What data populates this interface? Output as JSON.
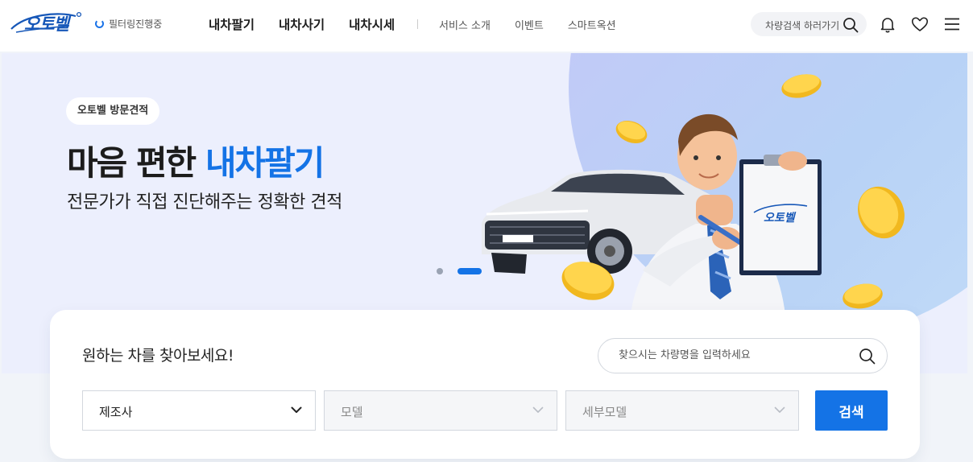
{
  "header": {
    "logo_text": "오토벨",
    "filter_status": "필터링진행중",
    "nav_main": [
      "내차팔기",
      "내차사기",
      "내차시세"
    ],
    "nav_sub": [
      "서비스 소개",
      "이벤트",
      "스마트옥션"
    ],
    "search_label": "차량검색 하러가기",
    "icons": [
      "search-icon",
      "bell-icon",
      "heart-icon",
      "menu-icon"
    ]
  },
  "hero": {
    "badge": "오토벨 방문견적",
    "title_main": "마음 편한 ",
    "title_accent": "내차팔기",
    "subtitle": "전문가가 직접 진단해주는 정확한 견적",
    "clipboard_logo": "오토벨",
    "slides_total": 2,
    "slide_active": 2
  },
  "search_card": {
    "title": "원하는 차를 찾아보세요!",
    "search_placeholder": "찾으시는 차량명을 입력하세요",
    "select_maker": "제조사",
    "select_model": "모델",
    "select_submodel": "세부모델",
    "search_button": "검색"
  },
  "colors": {
    "brand": "#1473e6",
    "logo": "#1657b8",
    "hero_bg": "#eceffd",
    "page_bg": "#f1f4f9"
  }
}
